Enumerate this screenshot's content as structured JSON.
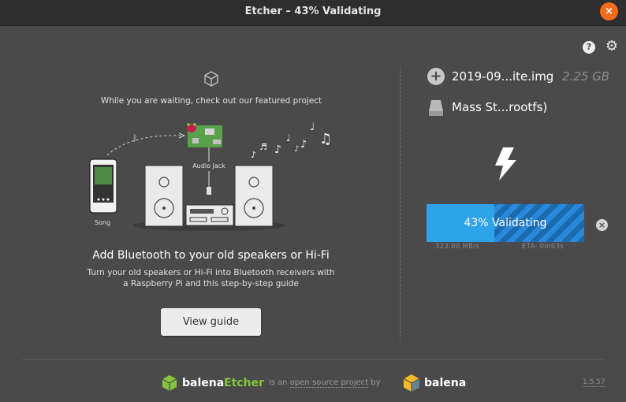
{
  "window": {
    "title": "Etcher – 43% Validating",
    "close_glyph": "×"
  },
  "header": {
    "help_glyph": "?",
    "settings_glyph": "⚙"
  },
  "featured": {
    "caption": "While you are waiting, check out our featured project",
    "illustration": {
      "audio_jack_label": "Audio Jack",
      "song_label": "Song"
    },
    "title": "Add Bluetooth to your old speakers or Hi-Fi",
    "description": "Turn your old speakers or Hi-Fi into Bluetooth receivers with a Raspberry Pi and this step-by-step guide",
    "button_label": "View guide"
  },
  "image": {
    "name": "2019-09...ite.img",
    "size": "2.25 GB",
    "icon": "plus-circle-icon",
    "icon_glyph": "+"
  },
  "drive": {
    "name": "Mass St...rootfs)",
    "icon": "drive-icon"
  },
  "flash": {
    "icon": "lightning-icon"
  },
  "progress": {
    "percent": 43,
    "label": "43% Validating",
    "speed": "323.00 MB/s",
    "eta": "ETA: 0m03s",
    "cancel_glyph": "×"
  },
  "footer": {
    "brand_prefix": "balena",
    "brand_suffix": "Etcher",
    "oss_before": "is an ",
    "oss_link": "open source project",
    "oss_after": " by",
    "balena": "balena",
    "version": "1.5.57"
  },
  "colors": {
    "background": "#4a4a4a",
    "titlebar": "#2e2e2e",
    "close": "#f46b1e",
    "progress": "#2ea3ea",
    "etcher_green": "#85c53f",
    "balena_yellow": "#f5b923"
  }
}
